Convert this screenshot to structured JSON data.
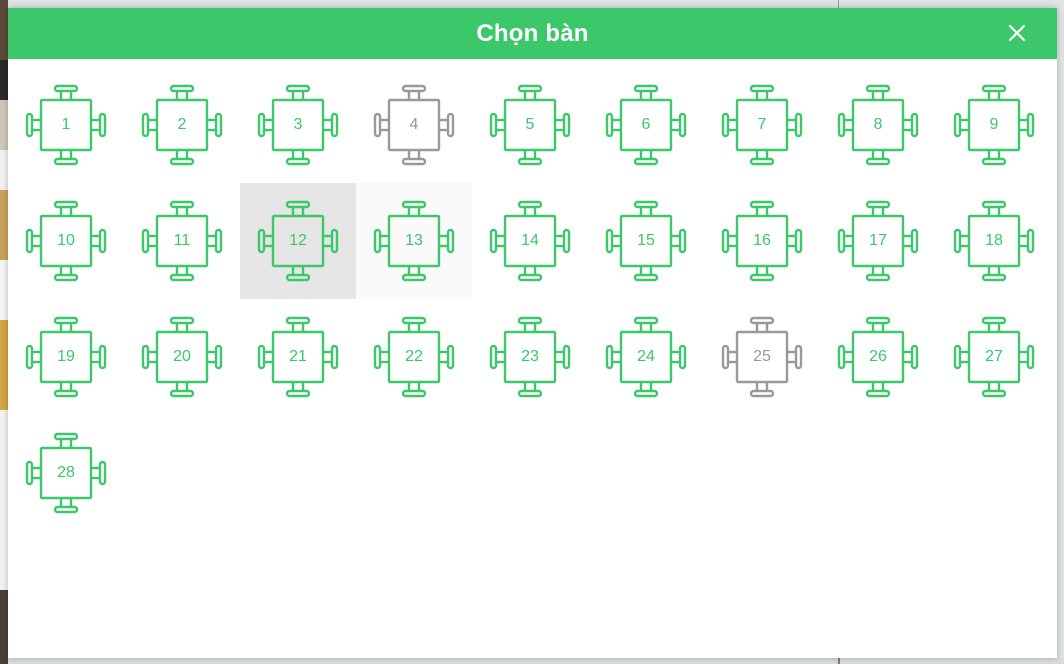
{
  "modal": {
    "title": "Chọn bàn",
    "close_icon": "close-icon"
  },
  "colors": {
    "header": "#3bc76a",
    "available": "#3bc76a",
    "unavailable": "#999999",
    "selected_bg": "#e6e6e6"
  },
  "tables": [
    {
      "label": "1",
      "status": "available"
    },
    {
      "label": "2",
      "status": "available"
    },
    {
      "label": "3",
      "status": "available"
    },
    {
      "label": "4",
      "status": "unavailable"
    },
    {
      "label": "5",
      "status": "available"
    },
    {
      "label": "6",
      "status": "available"
    },
    {
      "label": "7",
      "status": "available"
    },
    {
      "label": "8",
      "status": "available"
    },
    {
      "label": "9",
      "status": "available"
    },
    {
      "label": "10",
      "status": "available"
    },
    {
      "label": "11",
      "status": "available"
    },
    {
      "label": "12",
      "status": "available",
      "selected": true
    },
    {
      "label": "13",
      "status": "available",
      "hover": true
    },
    {
      "label": "14",
      "status": "available"
    },
    {
      "label": "15",
      "status": "available"
    },
    {
      "label": "16",
      "status": "available"
    },
    {
      "label": "17",
      "status": "available"
    },
    {
      "label": "18",
      "status": "available"
    },
    {
      "label": "19",
      "status": "available"
    },
    {
      "label": "20",
      "status": "available"
    },
    {
      "label": "21",
      "status": "available"
    },
    {
      "label": "22",
      "status": "available"
    },
    {
      "label": "23",
      "status": "available"
    },
    {
      "label": "24",
      "status": "available"
    },
    {
      "label": "25",
      "status": "unavailable"
    },
    {
      "label": "26",
      "status": "available"
    },
    {
      "label": "27",
      "status": "available"
    },
    {
      "label": "28",
      "status": "available"
    }
  ]
}
